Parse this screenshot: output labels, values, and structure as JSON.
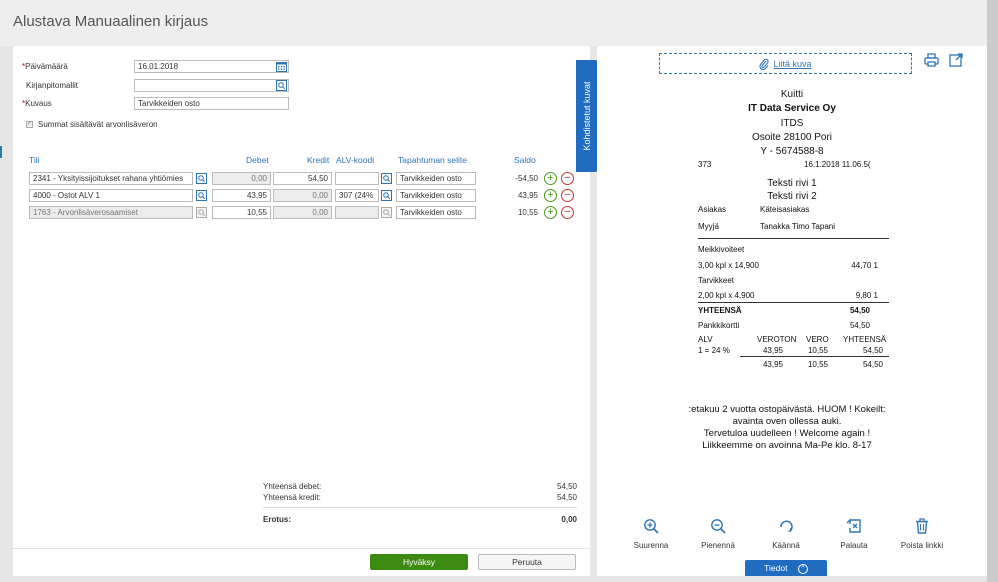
{
  "page_title": "Alustava Manuaalinen kirjaus",
  "form": {
    "date_label": "Päivämäärä",
    "date_value": "16.01.2018",
    "template_label": "Kirjanpitomallit",
    "template_value": "",
    "desc_label": "Kuvaus",
    "desc_value": "Tarvikkeiden osto",
    "checkbox_label": "Summat sisältävät arvonlisäveron"
  },
  "table": {
    "headers": {
      "account": "Tili",
      "debit": "Debet",
      "credit": "Kredit",
      "vat": "ALV-koodi",
      "desc": "Tapahtuman selite",
      "balance": "Saldo"
    },
    "rows": [
      {
        "account": "2341 - Yksityissijoitukset rahana yhtiömies",
        "debit": "0,00",
        "credit": "54,50",
        "vat": "",
        "desc": "Tarvikkeiden osto",
        "balance": "-54,50"
      },
      {
        "account": "4000 - Ostot ALV 1",
        "debit": "43,95",
        "credit": "0,00",
        "vat": "307 (24%",
        "desc": "Tarvikkeiden osto",
        "balance": "43,95"
      },
      {
        "account": "1763 - Arvonlisäverosaamiset",
        "debit": "10,55",
        "credit": "0,00",
        "vat": "",
        "desc": "Tarvikkeiden osto",
        "balance": "10,55"
      }
    ]
  },
  "totals": {
    "debit_label": "Yhteensä debet:",
    "debit_value": "54,50",
    "credit_label": "Yhteensä kredit:",
    "credit_value": "54,50",
    "diff_label": "Erotus:",
    "diff_value": "0,00"
  },
  "side_tab": "Kohdistetut kuvat",
  "buttons": {
    "approve": "Hyväksy",
    "cancel": "Peruuta",
    "details": "Tiedot"
  },
  "attach_label": "Liitä kuva",
  "receipt": {
    "l1": "Kuitti",
    "l2": "IT Data Service Oy",
    "l3": "ITDS",
    "l4": "Osoite 28100 Pori",
    "l5": "Y - 5674588-8",
    "num": "373",
    "datetime": "16.1.2018 11.06.5(",
    "t1": "Teksti rivi 1",
    "t2": "Teksti rivi 2",
    "cust_label": "Asiakas",
    "cust_value": "Käteisasiakas",
    "seller_label": "Myyjä",
    "seller_value": "Tanakka Timo Tapani",
    "grp1": "Meikkivoiteet",
    "grp1_qty": "3,00 kpl x 14,900",
    "grp1_sum": "44,70 1",
    "grp2": "Tarvikkeet",
    "grp2_qty": "2,00 kpl x 4,900",
    "grp2_sum": "9,80 1",
    "total_label": "YHTEENSÄ",
    "total_value": "54,50",
    "card_label": "Pankkikortti",
    "card_value": "54,50",
    "vat_h1": "ALV",
    "vat_h2": "VEROTON",
    "vat_h3": "VERO",
    "vat_h4": "YHTEENSÄ",
    "vat_r1": "1 = 24 %",
    "vat_r2": "43,95",
    "vat_r3": "10,55",
    "vat_r4": "54,50",
    "sum_r2": "43,95",
    "sum_r3": "10,55",
    "sum_r4": "54,50",
    "f1": ":etakuu 2 vuotta ostopäivästä. HUOM ! Kokeilt:",
    "f2": "avainta oven ollessa auki.",
    "f3": "Tervetuloa uudelleen ! Welcome again !",
    "f4": "Liikkeemme on avoinna Ma-Pe klo. 8-17"
  },
  "tools": {
    "zoom_in": "Suurenna",
    "zoom_out": "Pienennä",
    "rotate": "Käännä",
    "restore": "Palauta",
    "remove": "Poista linkki"
  },
  "colors": {
    "accent": "#2e75b6",
    "approve": "#3d8a12",
    "tab": "#1f6cc0",
    "required": "#cc0000"
  }
}
